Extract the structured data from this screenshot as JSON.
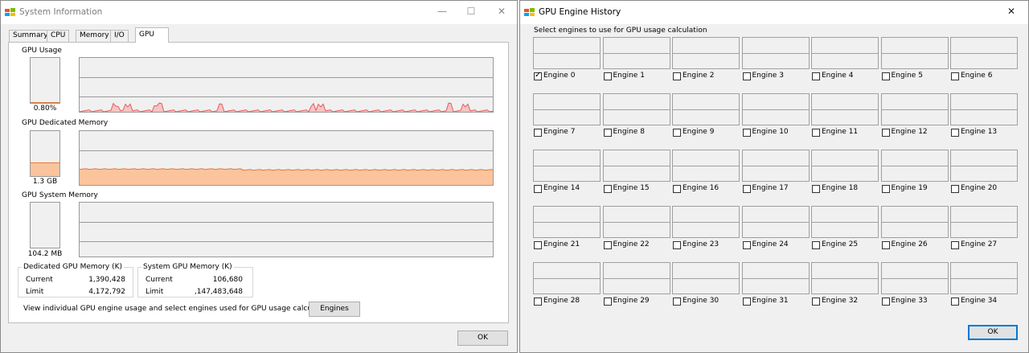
{
  "sysinfo": {
    "title": "System Information",
    "controls": {
      "minimize": "—",
      "maximize": "☐",
      "close": "✕"
    },
    "tabs": [
      "Summary",
      "CPU",
      "Memory",
      "I/O",
      "GPU"
    ],
    "gpu_usage": {
      "label": "GPU Usage",
      "value": "0.80%",
      "level": 0.008
    },
    "dedicated_memory": {
      "label": "GPU Dedicated Memory",
      "value": "1.3 GB",
      "level": 0.31
    },
    "system_memory": {
      "label": "GPU System Memory",
      "value": "104.2 MB",
      "level": 0.0
    },
    "dedicated_group": {
      "title": "Dedicated GPU Memory (K)",
      "current_label": "Current",
      "current": "1,390,428",
      "limit_label": "Limit",
      "limit": "4,172,792"
    },
    "system_group": {
      "title": "System GPU Memory (K)",
      "current_label": "Current",
      "current": "106,680",
      "limit_label": "Limit",
      "limit": ",147,483,648"
    },
    "engines_text": "View individual GPU engine usage and select engines used for GPU usage calculations:",
    "engines_button": "Engines",
    "ok_button": "OK"
  },
  "history": {
    "title": "GPU Engine History",
    "close": "✕",
    "select_label": "Select engines to use for GPU usage calculation",
    "engines": [
      {
        "label": "Engine 0",
        "checked": true
      },
      {
        "label": "Engine 1",
        "checked": false
      },
      {
        "label": "Engine 2",
        "checked": false
      },
      {
        "label": "Engine 3",
        "checked": false
      },
      {
        "label": "Engine 4",
        "checked": false
      },
      {
        "label": "Engine 5",
        "checked": false
      },
      {
        "label": "Engine 6",
        "checked": false
      },
      {
        "label": "Engine 7",
        "checked": false
      },
      {
        "label": "Engine 8",
        "checked": false
      },
      {
        "label": "Engine 9",
        "checked": false
      },
      {
        "label": "Engine 10",
        "checked": false
      },
      {
        "label": "Engine 11",
        "checked": false
      },
      {
        "label": "Engine 12",
        "checked": false
      },
      {
        "label": "Engine 13",
        "checked": false
      },
      {
        "label": "Engine 14",
        "checked": false
      },
      {
        "label": "Engine 15",
        "checked": false
      },
      {
        "label": "Engine 16",
        "checked": false
      },
      {
        "label": "Engine 17",
        "checked": false
      },
      {
        "label": "Engine 18",
        "checked": false
      },
      {
        "label": "Engine 19",
        "checked": false
      },
      {
        "label": "Engine 20",
        "checked": false
      },
      {
        "label": "Engine 21",
        "checked": false
      },
      {
        "label": "Engine 22",
        "checked": false
      },
      {
        "label": "Engine 23",
        "checked": false
      },
      {
        "label": "Engine 24",
        "checked": false
      },
      {
        "label": "Engine 25",
        "checked": false
      },
      {
        "label": "Engine 26",
        "checked": false
      },
      {
        "label": "Engine 27",
        "checked": false
      },
      {
        "label": "Engine 28",
        "checked": false
      },
      {
        "label": "Engine 29",
        "checked": false
      },
      {
        "label": "Engine 30",
        "checked": false
      },
      {
        "label": "Engine 31",
        "checked": false
      },
      {
        "label": "Engine 32",
        "checked": false
      },
      {
        "label": "Engine 33",
        "checked": false
      },
      {
        "label": "Engine 34",
        "checked": false
      }
    ],
    "ok_button": "OK"
  },
  "colors": {
    "usage_line": "#e06060",
    "usage_fill": "#f7c4c4",
    "memory_line": "#e07a3c",
    "memory_fill": "#fbc49c",
    "accent": "#0078d7"
  }
}
